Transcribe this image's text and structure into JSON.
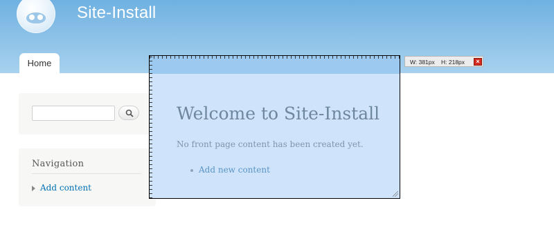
{
  "header": {
    "site_name": "Site-Install",
    "logo_icon": "drupal-drop-icon",
    "tabs": [
      {
        "label": "Home",
        "active": true
      }
    ]
  },
  "sidebar": {
    "search": {
      "value": "",
      "placeholder": "",
      "button_icon": "search-icon"
    },
    "navigation": {
      "title": "Navigation",
      "items": [
        {
          "label": "Add content"
        }
      ]
    }
  },
  "overlay": {
    "title": "Welcome to Site-Install",
    "message": "No front page content has been created yet.",
    "links": [
      {
        "label": "Add new content"
      }
    ]
  },
  "measure": {
    "width_label": "W: 381px",
    "height_label": "H: 218px",
    "close_icon": "close-icon"
  },
  "colors": {
    "header_top": "#6fb1e1",
    "header_bottom": "#a7d1ee",
    "overlay_bg": "#cfe4fb",
    "link": "#0071b3",
    "close": "#d52a1c"
  }
}
